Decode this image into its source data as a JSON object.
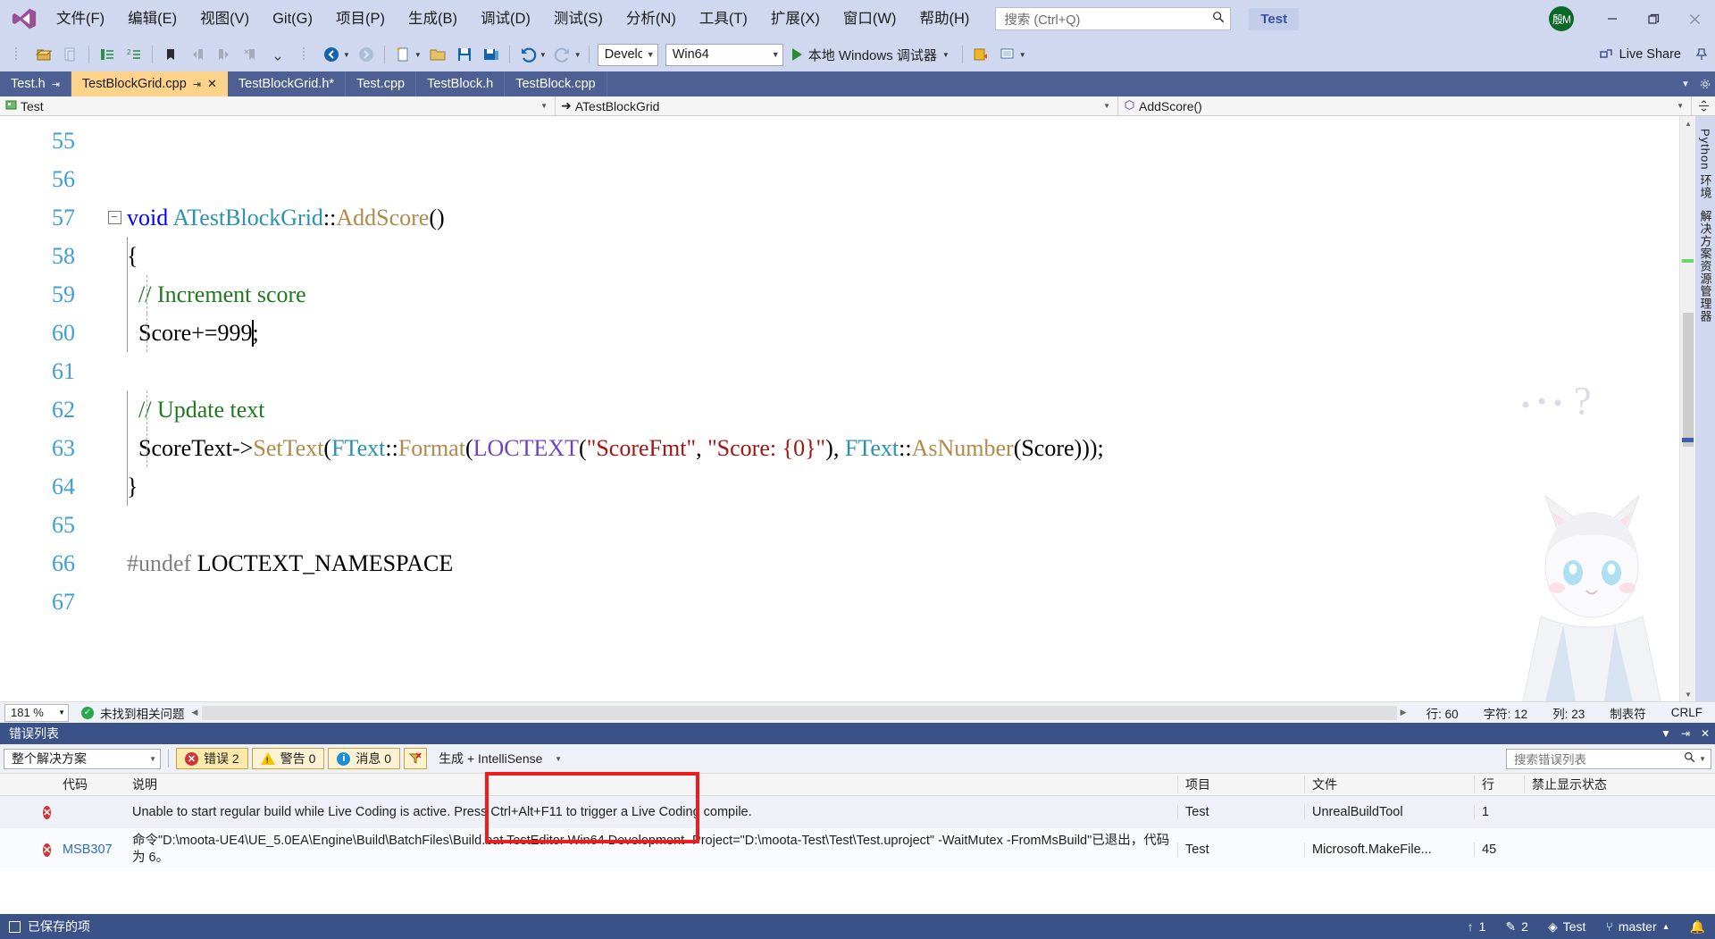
{
  "titlebar": {
    "menus": [
      {
        "label": "文件(F)",
        "key": "F"
      },
      {
        "label": "编辑(E)",
        "key": "E"
      },
      {
        "label": "视图(V)",
        "key": "V"
      },
      {
        "label": "Git(G)",
        "key": "G"
      },
      {
        "label": "项目(P)",
        "key": "P"
      },
      {
        "label": "生成(B)",
        "key": "B"
      },
      {
        "label": "调试(D)",
        "key": "D"
      },
      {
        "label": "测试(S)",
        "key": "S"
      },
      {
        "label": "分析(N)",
        "key": "N"
      },
      {
        "label": "工具(T)",
        "key": "T"
      },
      {
        "label": "扩展(X)",
        "key": "X"
      },
      {
        "label": "窗口(W)",
        "key": "W"
      },
      {
        "label": "帮助(H)",
        "key": "H"
      }
    ],
    "search_placeholder": "搜索 (Ctrl+Q)",
    "solution_name": "Test",
    "avatar_initials": "殷M",
    "minimize": "—",
    "restore": "❐",
    "close": "✕"
  },
  "toolbar": {
    "config": "Development",
    "platform": "Win64",
    "run_label": "本地 Windows 调试器",
    "live_share": "Live Share"
  },
  "tabs": [
    {
      "label": "Test.h",
      "active": false,
      "pinned": true,
      "closable": false
    },
    {
      "label": "TestBlockGrid.cpp",
      "active": true,
      "pinned": true,
      "closable": true
    },
    {
      "label": "TestBlockGrid.h*",
      "active": false,
      "pinned": false,
      "closable": false
    },
    {
      "label": "Test.cpp",
      "active": false,
      "pinned": false,
      "closable": false
    },
    {
      "label": "TestBlock.h",
      "active": false,
      "pinned": false,
      "closable": false
    },
    {
      "label": "TestBlock.cpp",
      "active": false,
      "pinned": false,
      "closable": false
    }
  ],
  "navbar": {
    "project": "Test",
    "class": "ATestBlockGrid",
    "member": "AddScore()"
  },
  "editor": {
    "lines": [
      {
        "num": "55",
        "modified": false,
        "fold": false,
        "html": ""
      },
      {
        "num": "56",
        "modified": false,
        "fold": false,
        "html": ""
      },
      {
        "num": "57",
        "modified": false,
        "fold": true,
        "html": "<span class='kw'>void</span> <span class='type'>ATestBlockGrid</span><span class='pln'>::</span><span class='fn'>AddScore</span><span class='pln'>()</span>"
      },
      {
        "num": "58",
        "modified": false,
        "fold": false,
        "html": "<span class='pln'>{</span>"
      },
      {
        "num": "59",
        "modified": false,
        "fold": false,
        "html": "  <span class='com'>// Increment score</span>"
      },
      {
        "num": "60",
        "modified": true,
        "fold": false,
        "html": "  <span class='pln'>Score+=999</span><span class='caret'></span><span class='pln'>;</span>"
      },
      {
        "num": "61",
        "modified": false,
        "fold": false,
        "html": ""
      },
      {
        "num": "62",
        "modified": false,
        "fold": false,
        "html": "  <span class='com'>// Update text</span>"
      },
      {
        "num": "63",
        "modified": false,
        "fold": false,
        "html": "  <span class='pln'>ScoreText-&gt;</span><span class='fn'>SetText</span><span class='pln'>(</span><span class='type'>FText</span><span class='pln'>::</span><span class='fn'>Format</span><span class='pln'>(</span><span class='mac'>LOCTEXT</span><span class='pln'>(</span><span class='str'>\"ScoreFmt\"</span><span class='pln'>, </span><span class='str'>\"Score: {0}\"</span><span class='pln'>), </span><span class='type'>FText</span><span class='pln'>::</span><span class='fn'>AsNumber</span><span class='pln'>(Score)));</span>"
      },
      {
        "num": "64",
        "modified": false,
        "fold": false,
        "html": "<span class='pln'>}</span>"
      },
      {
        "num": "65",
        "modified": false,
        "fold": false,
        "html": ""
      },
      {
        "num": "66",
        "modified": false,
        "fold": false,
        "html": "<span class='pp'>#undef</span> <span class='pln'>LOCTEXT_NAMESPACE</span>"
      },
      {
        "num": "67",
        "modified": false,
        "fold": false,
        "html": ""
      }
    ],
    "raw_text": "void ATestBlockGrid::AddScore()\n{\n\t// Increment score\n\tScore+=999;\n\n\t// Update text\n\tScoreText->SetText(FText::Format(LOCTEXT(\"ScoreFmt\", \"Score: {0}\"), FText::AsNumber(Score)));\n}\n\n#undef LOCTEXT_NAMESPACE"
  },
  "right_dock": {
    "tabs": [
      "Python 环境",
      "解决方案资源管理器"
    ]
  },
  "editor_status": {
    "zoom": "181 %",
    "issues": "未找到相关问题",
    "line_label": "行: 60",
    "char_label": "字符: 12",
    "col_label": "列: 23",
    "tab_label": "制表符",
    "eol": "CRLF"
  },
  "error_list": {
    "title": "错误列表",
    "scope": "整个解决方案",
    "errors_label": "错误 2",
    "warnings_label": "警告 0",
    "messages_label": "消息 0",
    "build_filter": "生成 + IntelliSense",
    "search_placeholder": "搜索错误列表",
    "columns": [
      "",
      "代码",
      "说明",
      "项目",
      "文件",
      "行",
      "禁止显示状态"
    ],
    "rows": [
      {
        "severity": "error",
        "code": "",
        "description": "Unable to start regular build while Live Coding is active. Press Ctrl+Alt+F11 to trigger a Live Coding compile.",
        "project": "Test",
        "file": "UnrealBuildTool",
        "line": "1",
        "suppression": ""
      },
      {
        "severity": "error",
        "code": "MSB307",
        "description": "命令\"D:\\moota-UE4\\UE_5.0EA\\Engine\\Build\\BatchFiles\\Build.bat TestEditor Win64 Development -Project=\"D:\\moota-Test\\Test\\Test.uproject\" -WaitMutex -FromMsBuild\"已退出，代码为 6。",
        "project": "Test",
        "file": "Microsoft.MakeFile...",
        "line": "45",
        "suppression": ""
      }
    ]
  },
  "statusbar": {
    "saved": "已保存的项",
    "push_count": "1",
    "edit_count": "2",
    "repo": "Test",
    "branch": "master"
  },
  "colors": {
    "chrome": "#cfd8ee",
    "accent": "#3a5288",
    "tab_active": "#fdd28a",
    "tabstrip": "#4d5f93",
    "annotation": "#ee1c1c",
    "keyword": "#0000ff",
    "type": "#2b91af",
    "string": "#a31515",
    "comment": "#1f7a1f",
    "macro": "#6f42c1",
    "function": "#b08a4a",
    "linenum": "#3f9ed6"
  }
}
